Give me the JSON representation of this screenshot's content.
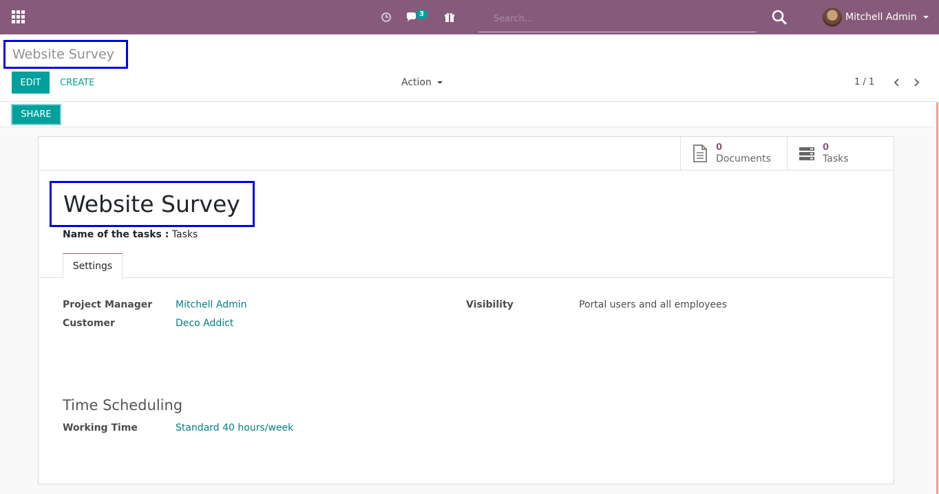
{
  "navbar": {
    "search_placeholder": "Search...",
    "messages_count": "3",
    "user_name": "Mitchell Admin",
    "colors": {
      "brand": "#875a7b",
      "accent": "#00a09d"
    }
  },
  "control_panel": {
    "breadcrumb": "Website Survey",
    "edit_label": "EDIT",
    "create_label": "CREATE",
    "action_label": "Action",
    "pager_value": "1 / 1"
  },
  "statusbar": {
    "share_label": "SHARE"
  },
  "sheet": {
    "stat_buttons": [
      {
        "value": "0",
        "label": "Documents",
        "icon": "document-icon"
      },
      {
        "value": "0",
        "label": "Tasks",
        "icon": "tasks-icon"
      }
    ],
    "title": "Website Survey",
    "task_name_label": "Name of the tasks :",
    "task_name_value": "Tasks",
    "tabs": [
      {
        "label": "Settings"
      }
    ],
    "fields": {
      "project_manager_label": "Project Manager",
      "project_manager_value": "Mitchell Admin",
      "customer_label": "Customer",
      "customer_value": "Deco Addict",
      "visibility_label": "Visibility",
      "visibility_value": "Portal users and all employees"
    },
    "time_scheduling": {
      "title": "Time Scheduling",
      "working_time_label": "Working Time",
      "working_time_value": "Standard 40 hours/week"
    }
  }
}
